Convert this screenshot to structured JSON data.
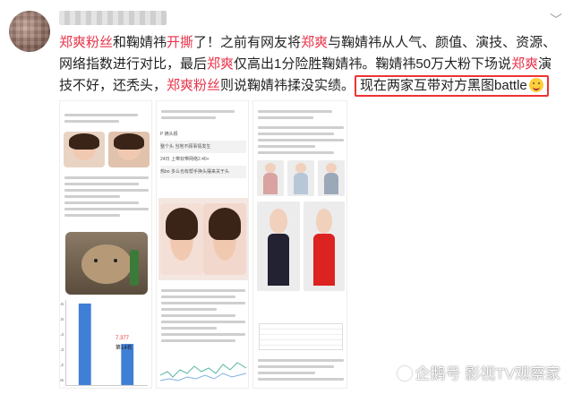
{
  "post": {
    "seg1": "郑爽粉丝",
    "seg2": "和鞠婧祎",
    "seg3": "开撕",
    "seg4": "了！之前有网友将",
    "seg5": "郑爽",
    "seg6": "与鞠婧祎从人气、颜值、演技、资源、网络指数进行对比，最后",
    "seg7": "郑爽",
    "seg8": "仅高出1分险胜鞠婧祎。鞠婧祎50万大粉下场说",
    "seg9": "郑爽",
    "seg10": "演技不好，还秃头，",
    "seg11": "郑爽粉丝",
    "seg12": "则说鞠婧祎揉没实绩。",
    "highlight": "现在两家互带对方黑图battle"
  },
  "images": {
    "img1_bar_label": "7.377",
    "img1_bar_label2": "第14名",
    "img1_ticks": [
      "7.6",
      "7.5",
      "7.4",
      "7.3",
      "7.2",
      "7.15"
    ],
    "img2_lines": [
      "P 摘头报",
      "整个头  当地不顾事情发生",
      "24日 上带双带网络2.40+",
      "热bo 多么也有帮手换头摆来关于头"
    ]
  },
  "chart_data": {
    "type": "bar",
    "categories": [
      "",
      ""
    ],
    "values": [
      7.6,
      7.377
    ],
    "ylim": [
      7.15,
      7.6
    ]
  },
  "watermark": {
    "text": "企鹅号 影视TV观察家"
  },
  "colors": {
    "accent_red": "#e8344a",
    "highlight_border": "#ee3333",
    "bar_blue": "#3f7fd6"
  }
}
